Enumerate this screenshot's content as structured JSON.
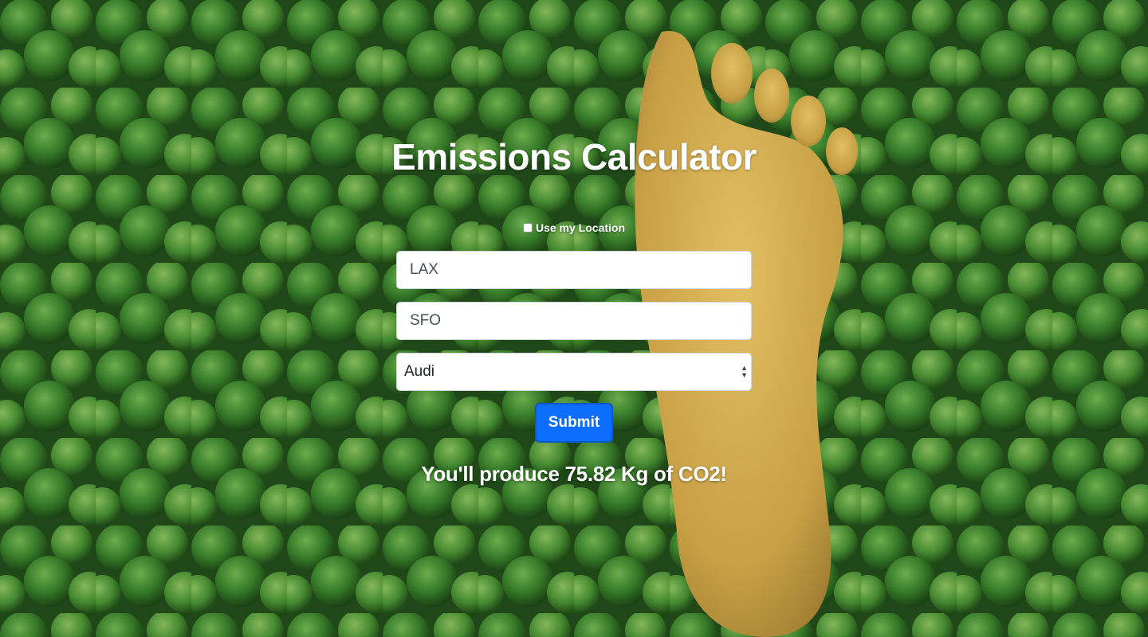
{
  "page": {
    "title": "Emissions Calculator"
  },
  "location": {
    "label": "Use my Location",
    "checked": false
  },
  "form": {
    "origin_value": "LAX",
    "destination_value": "SFO",
    "vehicle_selected": "Audi",
    "submit_label": "Submit"
  },
  "result": {
    "text": "You'll produce 75.82 Kg of CO2!"
  },
  "colors": {
    "submit_button": "#0d6efd",
    "forest_green": "#2e5e22",
    "footprint_gold": "#c9a24a"
  },
  "icons": {
    "select_caret": "up-down-caret-icon"
  }
}
